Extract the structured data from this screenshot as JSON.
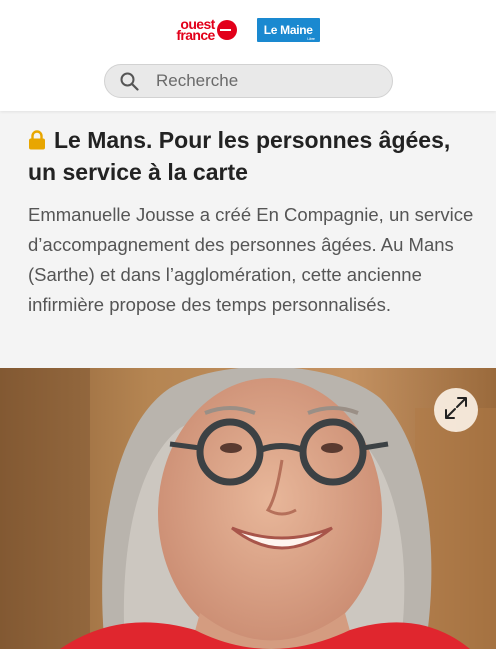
{
  "header": {
    "logo_ouest_france": {
      "line1": "ouest",
      "line2": "france"
    },
    "logo_le_maine": {
      "label": "Le Maine",
      "sub": "Libre"
    },
    "search": {
      "placeholder": "Recherche"
    }
  },
  "article": {
    "title": "Le Mans. Pour les personnes âgées, un service à la carte",
    "lead": "Emmanuelle Jousse a créé En Compagnie, un service d’accompagnement des personnes âgées. Au Mans (Sarthe) et dans l’agglomération, cette ancienne infirmière propose des temps personnalisés.",
    "premium_icon": "lock-icon"
  },
  "media": {
    "photo_icon": "portrait-photo",
    "expand_icon": "expand-arrows-icon"
  },
  "colors": {
    "brand_red": "#e2001a",
    "brand_blue": "#1a89d0",
    "lock_gold": "#e8a600"
  }
}
